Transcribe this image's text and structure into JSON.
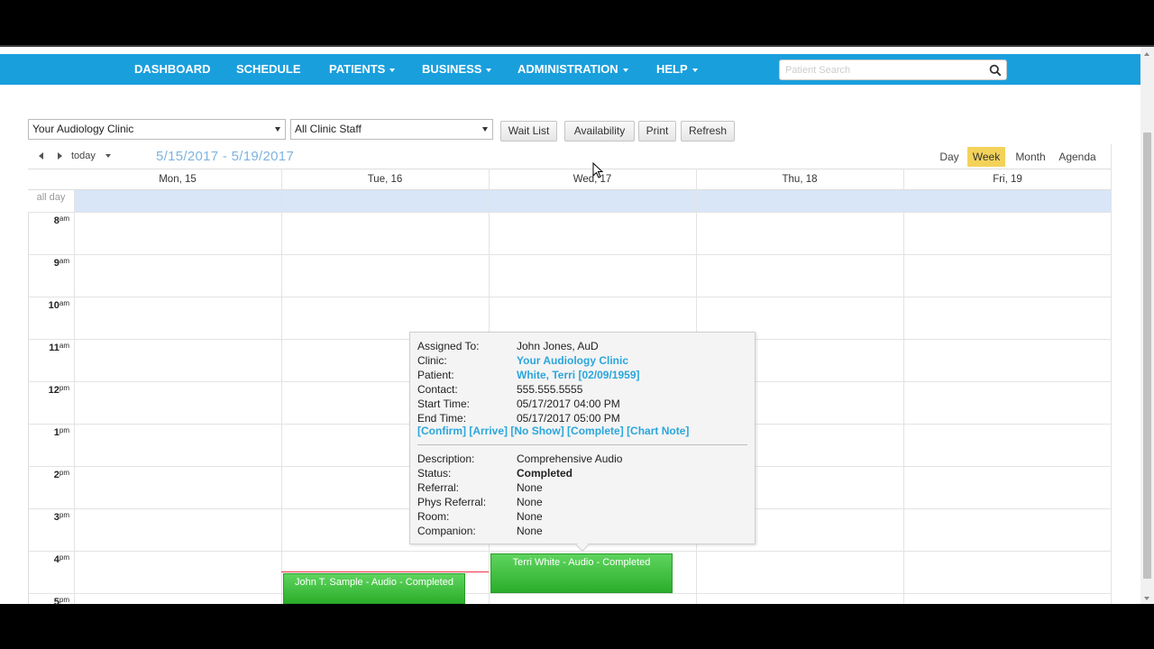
{
  "nav": {
    "items": [
      {
        "label": "DASHBOARD",
        "dropdown": false
      },
      {
        "label": "SCHEDULE",
        "dropdown": false
      },
      {
        "label": "PATIENTS",
        "dropdown": true
      },
      {
        "label": "BUSINESS",
        "dropdown": true
      },
      {
        "label": "ADMINISTRATION",
        "dropdown": true
      },
      {
        "label": "HELP",
        "dropdown": true
      }
    ],
    "search_placeholder": "Patient Search",
    "color": "#1a9fdd"
  },
  "toolbar": {
    "clinic_select": "Your Audiology Clinic",
    "staff_select": "All Clinic Staff",
    "buttons": [
      "Wait List",
      "Availability",
      "Print",
      "Refresh"
    ]
  },
  "calendar": {
    "today_label": "today",
    "date_range": "5/15/2017 - 5/19/2017",
    "views": [
      "Day",
      "Week",
      "Month",
      "Agenda"
    ],
    "active_view": "Week",
    "days": [
      "Mon, 15",
      "Tue, 16",
      "Wed, 17",
      "Thu, 18",
      "Fri, 19"
    ],
    "all_day_label": "all day",
    "hours": [
      {
        "h": "8",
        "p": "am"
      },
      {
        "h": "9",
        "p": "am"
      },
      {
        "h": "10",
        "p": "am"
      },
      {
        "h": "11",
        "p": "am"
      },
      {
        "h": "12",
        "p": "pm"
      },
      {
        "h": "1",
        "p": "pm"
      },
      {
        "h": "2",
        "p": "pm"
      },
      {
        "h": "3",
        "p": "pm"
      },
      {
        "h": "4",
        "p": "pm"
      },
      {
        "h": "5",
        "p": "pm"
      }
    ],
    "events": [
      {
        "label": "John T. Sample - Audio - Completed",
        "day": "Tue, 16"
      },
      {
        "label": "Terri White - Audio - Completed",
        "day": "Wed, 17"
      }
    ]
  },
  "popup": {
    "assigned_to_label": "Assigned To:",
    "assigned_to": "John Jones, AuD",
    "clinic_label": "Clinic:",
    "clinic": "Your Audiology Clinic",
    "patient_label": "Patient:",
    "patient": "White, Terri [02/09/1959]",
    "contact_label": "Contact:",
    "contact": "555.555.5555",
    "start_label": "Start Time:",
    "start": "05/17/2017 04:00 PM",
    "end_label": "End Time:",
    "end": "05/17/2017 05:00 PM",
    "actions": [
      "[Confirm]",
      "[Arrive]",
      "[No Show]",
      "[Complete]",
      "[Chart Note]"
    ],
    "description_label": "Description:",
    "description": "Comprehensive Audio",
    "status_label": "Status:",
    "status": "Completed",
    "referral_label": "Referral:",
    "referral": "None",
    "phys_referral_label": "Phys Referral:",
    "phys_referral": "None",
    "room_label": "Room:",
    "room": "None",
    "companion_label": "Companion:",
    "companion": "None"
  }
}
